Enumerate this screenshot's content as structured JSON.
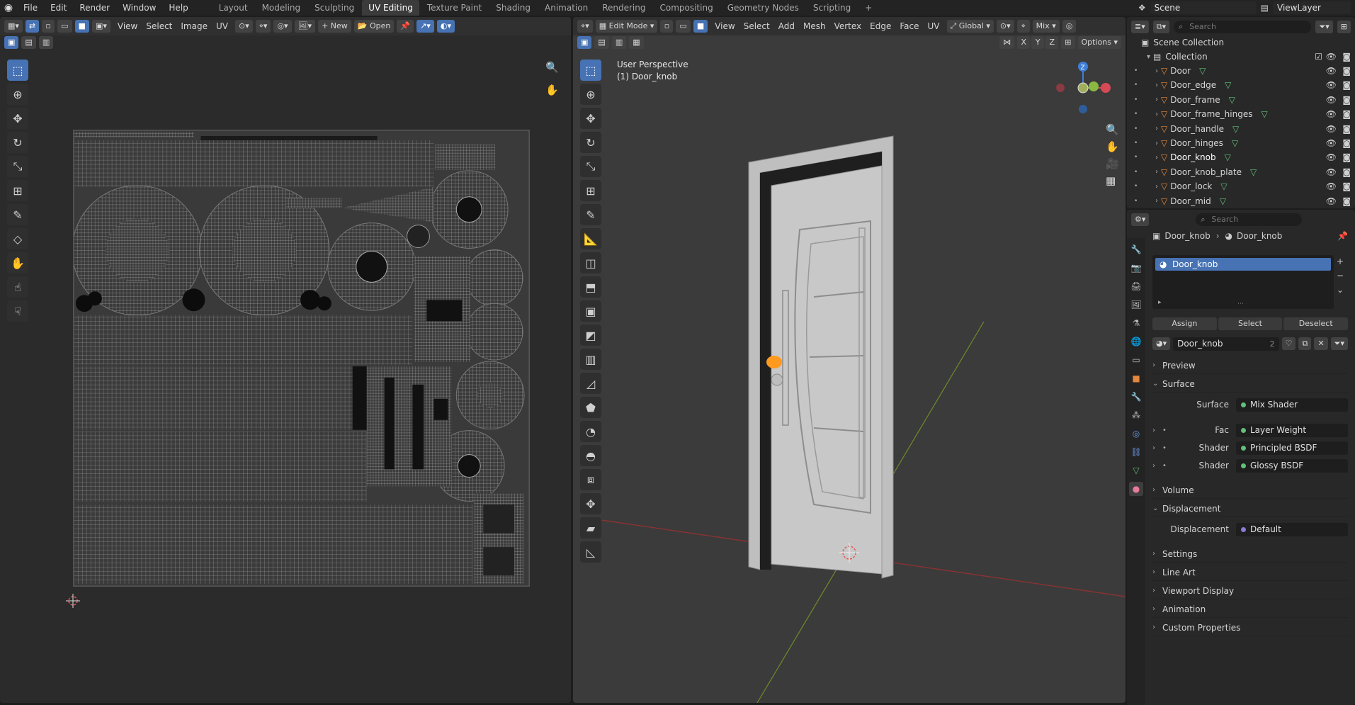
{
  "menu": [
    "File",
    "Edit",
    "Render",
    "Window",
    "Help"
  ],
  "workspaces": [
    {
      "label": "Layout",
      "active": false
    },
    {
      "label": "Modeling",
      "active": false
    },
    {
      "label": "Sculpting",
      "active": false
    },
    {
      "label": "UV Editing",
      "active": true
    },
    {
      "label": "Texture Paint",
      "active": false
    },
    {
      "label": "Shading",
      "active": false
    },
    {
      "label": "Animation",
      "active": false
    },
    {
      "label": "Rendering",
      "active": false
    },
    {
      "label": "Compositing",
      "active": false
    },
    {
      "label": "Geometry Nodes",
      "active": false
    },
    {
      "label": "Scripting",
      "active": false
    }
  ],
  "add_tab": "+",
  "scene": "Scene",
  "view_layer": "ViewLayer",
  "uv_editor": {
    "menus": [
      "View",
      "Select",
      "Image",
      "UV"
    ],
    "new_label": "New",
    "open_label": "Open"
  },
  "viewport": {
    "mode": "Edit Mode",
    "menus": [
      "View",
      "Select",
      "Add",
      "Mesh",
      "Vertex",
      "Edge",
      "Face",
      "UV"
    ],
    "orientation": "Global",
    "snap": "Mix",
    "axes": [
      "X",
      "Y",
      "Z"
    ],
    "options": "Options",
    "perspective": "User Perspective",
    "object": "(1) Door_knob",
    "gizmo_z": "Z"
  },
  "outliner": {
    "search_placeholder": "Search",
    "scene_collection": "Scene Collection",
    "collection": "Collection",
    "objects": [
      "Door",
      "Door_edge",
      "Door_frame",
      "Door_frame_hinges",
      "Door_handle",
      "Door_hinges",
      "Door_knob",
      "Door_knob_plate",
      "Door_lock",
      "Door_mid"
    ],
    "selected": "Door_knob"
  },
  "properties": {
    "search_placeholder": "Search",
    "breadcrumb_object": "Door_knob",
    "breadcrumb_material": "Door_knob",
    "slot": "Door_knob",
    "assign": "Assign",
    "select": "Select",
    "deselect": "Deselect",
    "material_name": "Door_knob",
    "user_count": "2",
    "sections": {
      "preview": "Preview",
      "surface": "Surface",
      "volume": "Volume",
      "displacement": "Displacement",
      "settings": "Settings",
      "line_art": "Line Art",
      "viewport_display": "Viewport Display",
      "animation": "Animation",
      "custom_properties": "Custom Properties"
    },
    "surface_label": "Surface",
    "surface_value": "Mix Shader",
    "fac_label": "Fac",
    "fac_value": "Layer Weight",
    "shader1_label": "Shader",
    "shader1_value": "Principled BSDF",
    "shader2_label": "Shader",
    "shader2_value": "Glossy BSDF",
    "displacement_label": "Displacement",
    "displacement_value": "Default"
  }
}
